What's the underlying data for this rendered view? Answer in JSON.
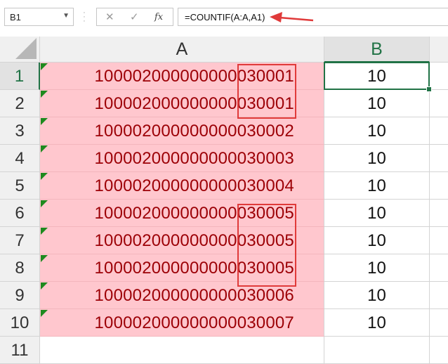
{
  "formula_bar": {
    "name_box": "B1",
    "cancel_icon": "✕",
    "enter_icon": "✓",
    "fx_label": "fx",
    "formula": "=COUNTIF(A:A,A1)"
  },
  "columns": [
    "A",
    "B"
  ],
  "rows": [
    {
      "num": "1",
      "a": "100002000000000030001",
      "b": "10"
    },
    {
      "num": "2",
      "a": "100002000000000030001",
      "b": "10"
    },
    {
      "num": "3",
      "a": "100002000000000030002",
      "b": "10"
    },
    {
      "num": "4",
      "a": "100002000000000030003",
      "b": "10"
    },
    {
      "num": "5",
      "a": "100002000000000030004",
      "b": "10"
    },
    {
      "num": "6",
      "a": "100002000000000030005",
      "b": "10"
    },
    {
      "num": "7",
      "a": "100002000000000030005",
      "b": "10"
    },
    {
      "num": "8",
      "a": "100002000000000030005",
      "b": "10"
    },
    {
      "num": "9",
      "a": "100002000000000030006",
      "b": "10"
    },
    {
      "num": "10",
      "a": "100002000000000030007",
      "b": "10"
    },
    {
      "num": "11",
      "a": "",
      "b": ""
    }
  ],
  "colors": {
    "accent": "#217346",
    "duplicate_fill": "#ffc7ce",
    "duplicate_text": "#9c0006",
    "annotation": "#e03a3a"
  }
}
